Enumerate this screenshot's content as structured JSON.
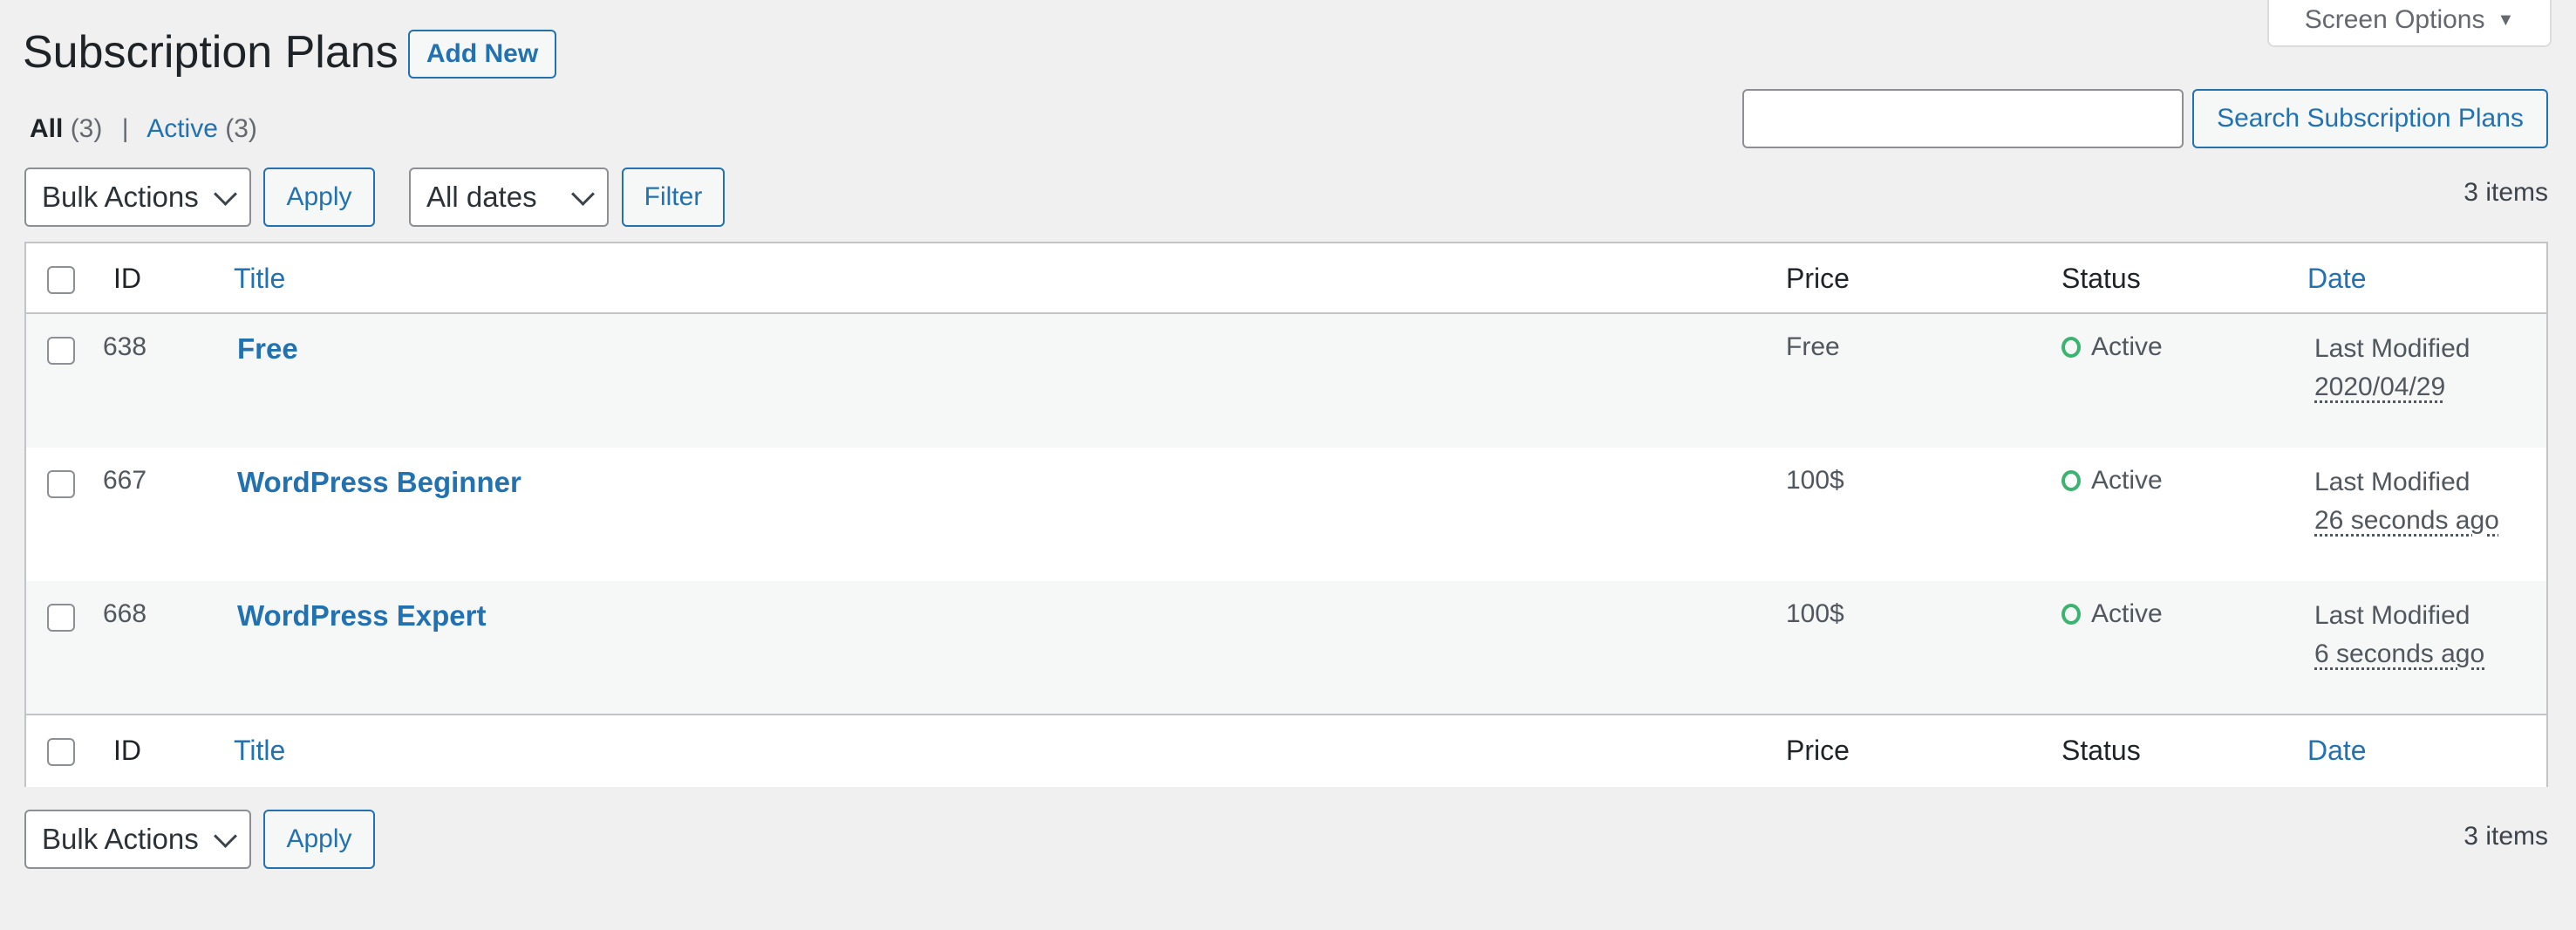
{
  "header": {
    "title": "Subscription Plans",
    "add_new_label": "Add New",
    "screen_options_label": "Screen Options",
    "screen_options_icon": "triangle-down-icon"
  },
  "views": {
    "all_label": "All",
    "all_count": "(3)",
    "separator": "|",
    "active_label": "Active",
    "active_count": "(3)"
  },
  "search": {
    "value": "",
    "placeholder": "",
    "button_label": "Search Subscription Plans"
  },
  "toolbar_top": {
    "bulk_actions_selected": "Bulk Actions",
    "apply_label": "Apply",
    "dates_selected": "All dates",
    "filter_label": "Filter",
    "items_count": "3 items"
  },
  "table": {
    "columns": {
      "id": "ID",
      "title": "Title",
      "price": "Price",
      "status": "Status",
      "date": "Date"
    },
    "rows": [
      {
        "id": "638",
        "title": "Free",
        "price": "Free",
        "status": "Active",
        "date_label": "Last Modified",
        "date_value": "2020/04/29"
      },
      {
        "id": "667",
        "title": "WordPress Beginner",
        "price": "100$",
        "status": "Active",
        "date_label": "Last Modified",
        "date_value": "26 seconds ago"
      },
      {
        "id": "668",
        "title": "WordPress Expert",
        "price": "100$",
        "status": "Active",
        "date_label": "Last Modified",
        "date_value": "6 seconds ago"
      }
    ]
  },
  "toolbar_bottom": {
    "bulk_actions_selected": "Bulk Actions",
    "apply_label": "Apply",
    "items_count": "3 items"
  },
  "colors": {
    "accent": "#2271b1",
    "status_active": "#3cb371",
    "background": "#f0f0f1"
  }
}
